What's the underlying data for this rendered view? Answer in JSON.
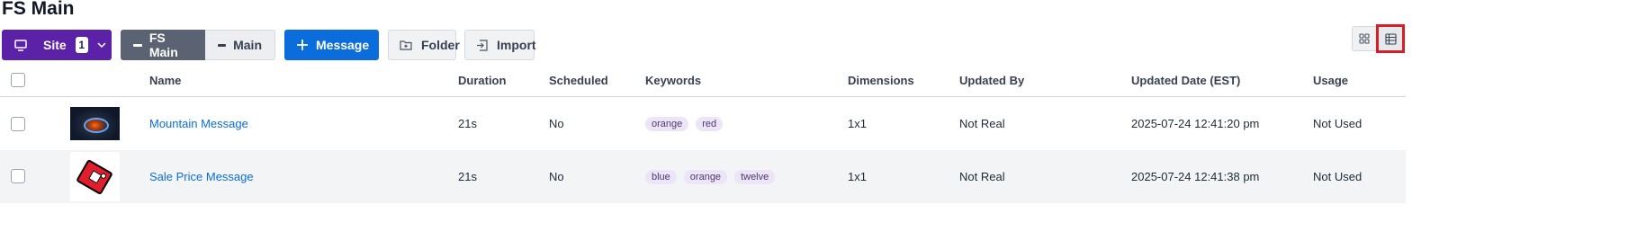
{
  "page": {
    "title": "FS Main"
  },
  "toolbar": {
    "site_label": "Site",
    "site_count": "1",
    "seg_active": "FS Main",
    "seg_inactive": "Main",
    "message_label": "Message",
    "folder_label": "Folder",
    "import_label": "Import",
    "accent_purple": "#5b21a6",
    "accent_blue": "#0b6ddb"
  },
  "view_toggle": {
    "selected": "list"
  },
  "table": {
    "headers": {
      "name": "Name",
      "duration": "Duration",
      "scheduled": "Scheduled",
      "keywords": "Keywords",
      "dimensions": "Dimensions",
      "updated_by": "Updated By",
      "updated_date": "Updated Date (EST)",
      "usage": "Usage"
    },
    "rows": [
      {
        "thumbnail": "mountain-message-thumbnail",
        "name": "Mountain Message",
        "duration": "21s",
        "scheduled": "No",
        "keywords": [
          "orange",
          "red"
        ],
        "dimensions": "1x1",
        "updated_by": "Not Real",
        "updated_date": "2025-07-24 12:41:20 pm",
        "usage": "Not Used"
      },
      {
        "thumbnail": "sale-price-tag-thumbnail",
        "name": "Sale Price Message",
        "duration": "21s",
        "scheduled": "No",
        "keywords": [
          "blue",
          "orange",
          "twelve"
        ],
        "dimensions": "1x1",
        "updated_by": "Not Real",
        "updated_date": "2025-07-24 12:41:38 pm",
        "usage": "Not Used"
      }
    ]
  }
}
